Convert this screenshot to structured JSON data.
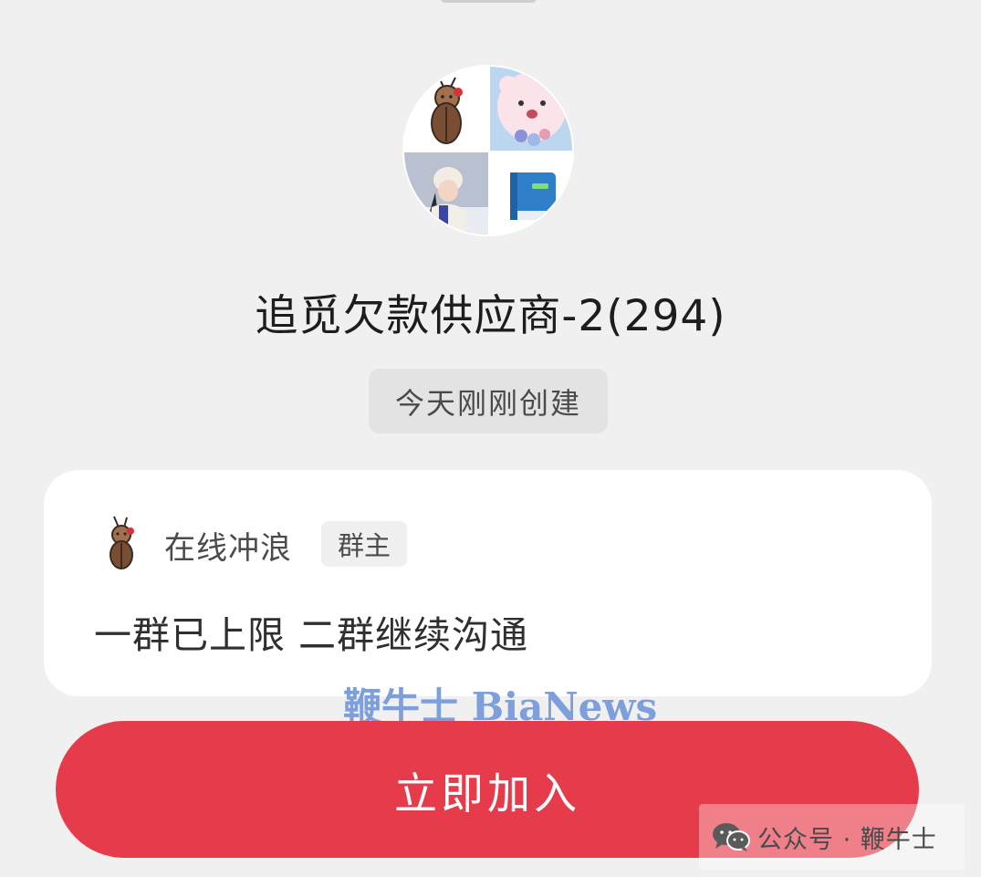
{
  "group": {
    "title": "追觅欠款供应商-2(294)",
    "created_label": "今天刚刚创建",
    "avatar_tiles": [
      "bug-cartoon-avatar",
      "pink-bear-flowers-avatar",
      "snow-girl-photo-avatar",
      "blue-book-avatar"
    ]
  },
  "owner_card": {
    "name": "在线冲浪",
    "role": "群主",
    "message": "一群已上限 二群继续沟通"
  },
  "join_button": {
    "label": "立即加入",
    "color": "#e63b4a"
  },
  "watermarks": {
    "center": "鞭牛士 BiaNews",
    "corner": "公众号 · 鞭牛士"
  }
}
